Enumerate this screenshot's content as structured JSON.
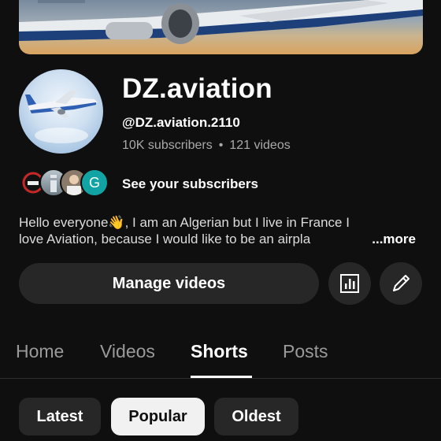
{
  "channel": {
    "name": "DZ.aviation",
    "handle": "@DZ.aviation.2110",
    "subscribers": "10K subscribers",
    "separator": "•",
    "videos": "121 videos"
  },
  "subscribers_row": {
    "label": "See your subscribers",
    "avatar_letter": "G"
  },
  "description": {
    "line1": "Hello everyone👋, I am an Algerian  but I live in France I",
    "line2": "love Aviation, because I would like to be an airpla",
    "more": "...more"
  },
  "actions": {
    "manage_label": "Manage videos",
    "analytics_icon": "analytics-icon",
    "edit_icon": "pencil-icon"
  },
  "tabs": [
    "Home",
    "Videos",
    "Shorts",
    "Posts"
  ],
  "active_tab": "Shorts",
  "filters": [
    "Latest",
    "Popular",
    "Oldest"
  ],
  "active_filter": "Popular",
  "colors": {
    "background": "#0f0f0f",
    "button_bg": "#272727",
    "muted_text": "#aaaaaa",
    "active_chip_bg": "#f1f1f1"
  }
}
